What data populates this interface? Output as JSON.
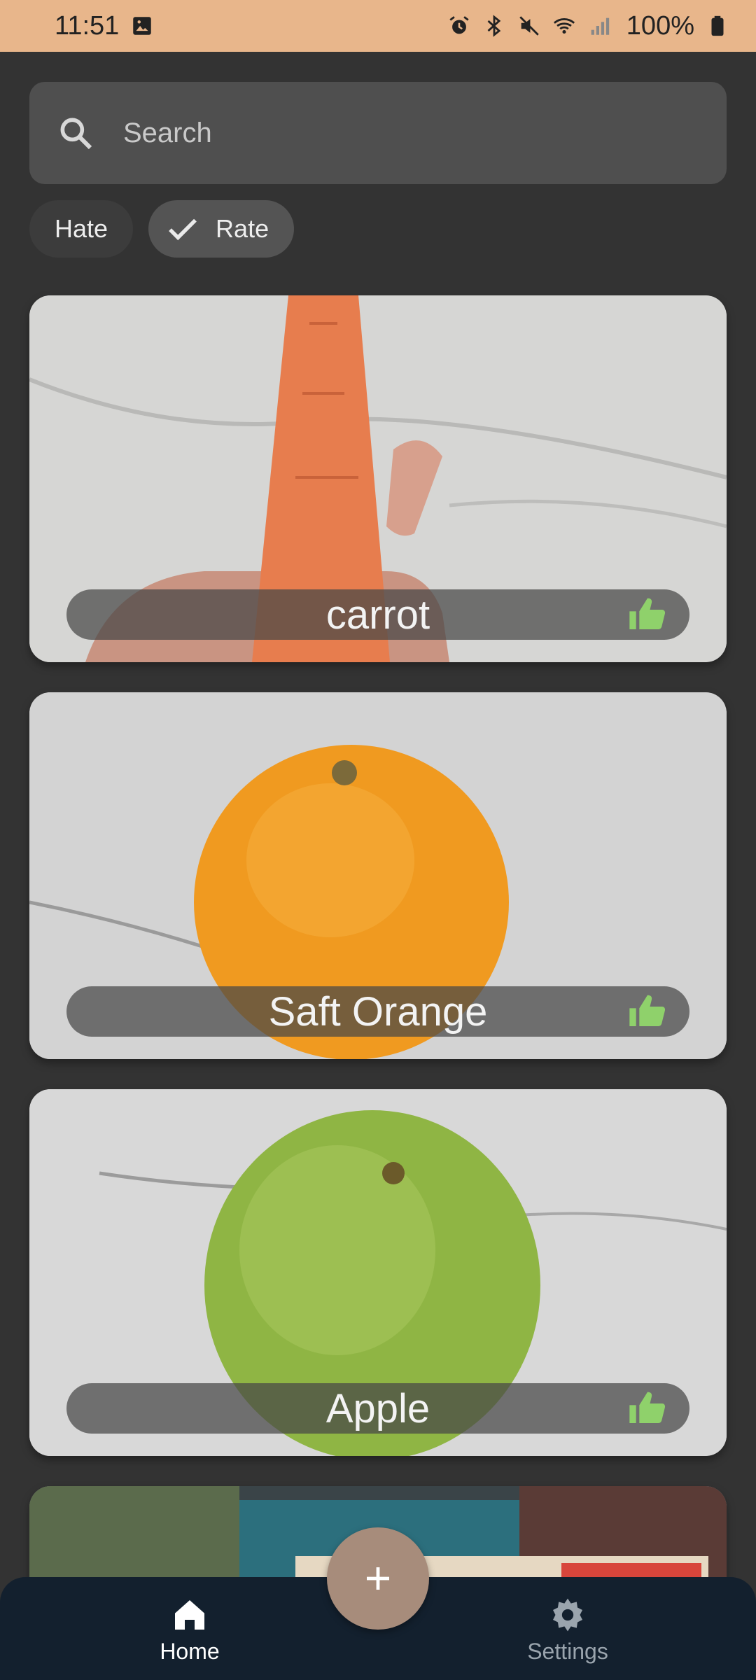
{
  "status_bar": {
    "time": "11:51",
    "battery": "100%"
  },
  "search": {
    "placeholder": "Search",
    "icon": "search-icon"
  },
  "filters": [
    {
      "label": "Hate",
      "selected": false
    },
    {
      "label": "Rate",
      "selected": true
    }
  ],
  "items": [
    {
      "name": "carrot",
      "rating_icon": "thumb-up-icon"
    },
    {
      "name": "Saft Orange",
      "rating_icon": "thumb-up-icon"
    },
    {
      "name": "Apple",
      "rating_icon": "thumb-up-icon"
    }
  ],
  "fab": {
    "icon": "plus-icon"
  },
  "nav": {
    "home_label": "Home",
    "settings_label": "Settings"
  },
  "colors": {
    "status_bar": "#e8b68b",
    "background": "#333333",
    "accent_thumb": "#8fd16b",
    "nav_bg": "#13202e",
    "fab": "#a78c7b"
  }
}
